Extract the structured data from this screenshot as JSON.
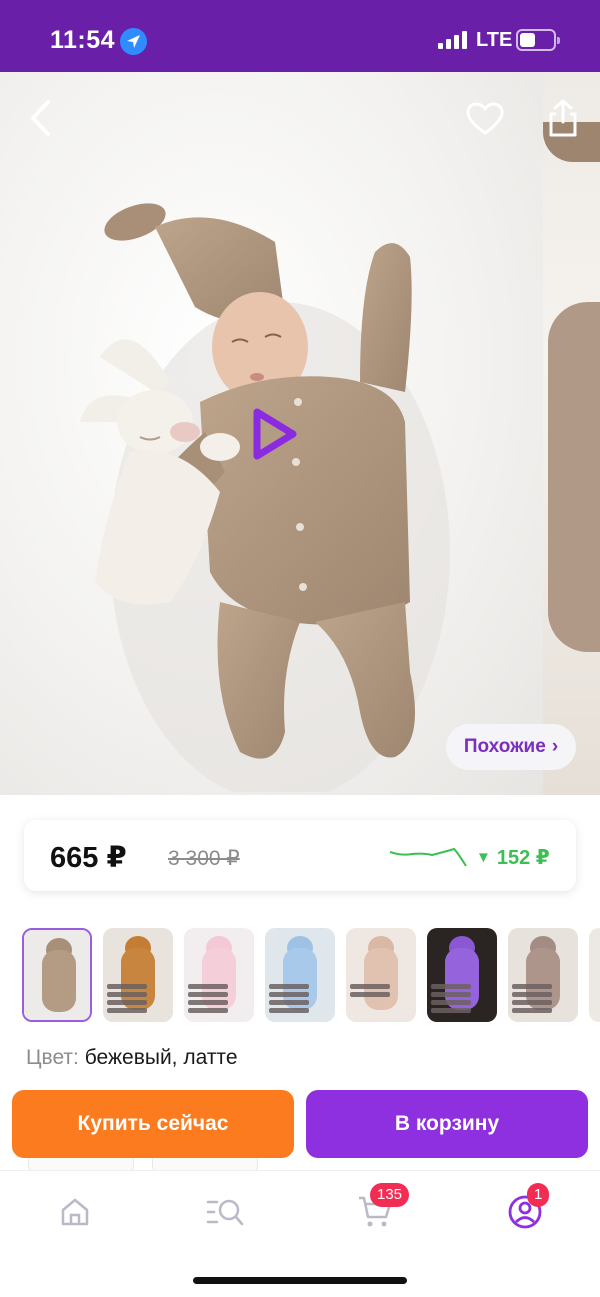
{
  "status_bar": {
    "time": "11:54",
    "network": "LTE",
    "icons": [
      "location-arrow-icon",
      "signal-icon",
      "battery-icon"
    ]
  },
  "hero": {
    "icons": [
      "back-chevron-icon",
      "heart-outline-icon",
      "share-icon",
      "play-icon"
    ],
    "similar_label": "Похожие",
    "similar_chevron": "›"
  },
  "price": {
    "current": "665 ₽",
    "old": "3 300 ₽",
    "drop": "152 ₽",
    "drop_arrow": "▼",
    "trend_color": "#3ebf53"
  },
  "thumbnails": {
    "count": 8,
    "selected_index": 0,
    "accent": "#9b5cde"
  },
  "color_selector": {
    "label": "Цвет:",
    "value": "бежевый, латте"
  },
  "actions": {
    "buy_now": "Купить сейчас",
    "add_to_cart": "В корзину",
    "buy_color": "#fb7b1e",
    "cart_color": "#8e2fe0"
  },
  "bottom_nav": {
    "items": [
      {
        "icon": "home-icon"
      },
      {
        "icon": "catalog-search-icon"
      },
      {
        "icon": "cart-icon",
        "badge": "135"
      },
      {
        "icon": "profile-icon",
        "badge": "1"
      }
    ]
  }
}
